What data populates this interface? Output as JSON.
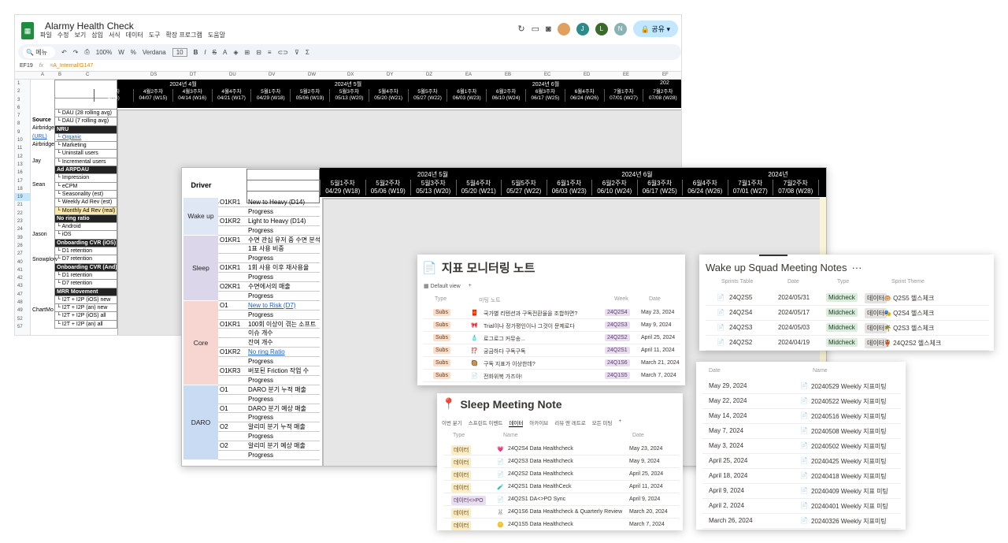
{
  "sheet1": {
    "title": "Alarmy Health Check",
    "menu": [
      "파일",
      "수정",
      "보기",
      "삽입",
      "서식",
      "데이터",
      "도구",
      "확장 프로그램",
      "도움말"
    ],
    "avatars": [
      "J",
      "L",
      "N"
    ],
    "share_label": "공유",
    "search_label": "메뉴",
    "zoom": "100%",
    "font": "Verdana",
    "font_size": "10",
    "cell_ref": "EF19",
    "formula": "=A_Internal!G147",
    "col_headers": [
      "A",
      "B",
      "C",
      "DS",
      "DT",
      "DU",
      "DV",
      "DW",
      "DX",
      "DY",
      "DZ",
      "EA",
      "EB",
      "EC",
      "ED",
      "EE",
      "EF"
    ],
    "row_numbers": [
      "1",
      "2",
      "3",
      "6",
      "7",
      "8",
      "9",
      "10",
      "11",
      "12",
      "13",
      "16",
      "17",
      "18",
      "19",
      "21",
      "22",
      "23",
      "24",
      "39",
      "26",
      "27",
      "40",
      "41",
      "42",
      "43",
      "47",
      "48",
      "49",
      "52",
      "57"
    ],
    "drivers": [
      "Source",
      "Airbridge",
      "(URL)",
      "Airbridge",
      "Jay",
      "Sean",
      "Jason",
      "Snowplow",
      "ChartMo"
    ],
    "labels": [
      {
        "text": "DAU (28 rolling avg)",
        "style": ""
      },
      {
        "text": "DAU (7 rolling avg)",
        "style": ""
      },
      {
        "text": "NRU",
        "style": "dark"
      },
      {
        "text": "Organic",
        "style": "link"
      },
      {
        "text": "Marketing",
        "style": ""
      },
      {
        "text": "Uninstall users",
        "style": ""
      },
      {
        "text": "Incremental users",
        "style": ""
      },
      {
        "text": "Ad ARPDAU",
        "style": "dark"
      },
      {
        "text": "Impression",
        "style": ""
      },
      {
        "text": "eCPM",
        "style": ""
      },
      {
        "text": "Seasonality (est)",
        "style": ""
      },
      {
        "text": "Weekly Ad Rev (est)",
        "style": ""
      },
      {
        "text": "Monthly Ad Rev (real)",
        "style": "hl"
      },
      {
        "text": "No ring ratio",
        "style": "dark"
      },
      {
        "text": "Android",
        "style": ""
      },
      {
        "text": "iOS",
        "style": ""
      },
      {
        "text": "Onboarding CVR (iOS)",
        "style": "dark"
      },
      {
        "text": "D1 retention",
        "style": ""
      },
      {
        "text": "D7 retention",
        "style": ""
      },
      {
        "text": "Onboarding CVR (And)",
        "style": "dark"
      },
      {
        "text": "D1 retention",
        "style": ""
      },
      {
        "text": "D7 retention",
        "style": ""
      },
      {
        "text": "MRR Movement",
        "style": "dark"
      },
      {
        "text": "I2T + I2P (iOS) new",
        "style": ""
      },
      {
        "text": "I2T + I2P (an) new",
        "style": ""
      },
      {
        "text": "I2T + I2P (iOS) all",
        "style": ""
      },
      {
        "text": "I2T + I2P (an) all",
        "style": ""
      }
    ],
    "month_groups": [
      "2024년 4월",
      "2024년 5월",
      "2024년 6월",
      "202"
    ],
    "weeks": [
      {
        "a": "3주차",
        "b": "4/14)"
      },
      {
        "a": "4월2주차",
        "b": "04/07 (W15)"
      },
      {
        "a": "4월3주차",
        "b": "04/14 (W16)"
      },
      {
        "a": "4월4주차",
        "b": "04/21 (W17)"
      },
      {
        "a": "5월1주차",
        "b": "04/29 (W18)"
      },
      {
        "a": "5월2주차",
        "b": "05/06 (W19)"
      },
      {
        "a": "5월3주차",
        "b": "05/13 (W20)"
      },
      {
        "a": "5월4주차",
        "b": "05/20 (W21)"
      },
      {
        "a": "5월5주차",
        "b": "05/27 (W22)"
      },
      {
        "a": "6월1주차",
        "b": "06/03 (W23)"
      },
      {
        "a": "6월2주차",
        "b": "06/10 (W24)"
      },
      {
        "a": "6월3주차",
        "b": "06/17 (W25)"
      },
      {
        "a": "6월4주차",
        "b": "06/24 (W26)"
      },
      {
        "a": "7월1주차",
        "b": "07/01 (W27)"
      },
      {
        "a": "7월2주차",
        "b": "07/08 (W28)"
      }
    ]
  },
  "sheet2": {
    "driver_label": "Driver",
    "month_groups": [
      "2024년 5월",
      "2024년 6월",
      "2024년"
    ],
    "weeks": [
      {
        "a": "5월1주차",
        "b": "04/29 (W18)"
      },
      {
        "a": "5월2주차",
        "b": "05/06 (W19)"
      },
      {
        "a": "5월3주차",
        "b": "05/13 (W20)"
      },
      {
        "a": "5월4주차",
        "b": "05/20 (W21)"
      },
      {
        "a": "5월5주차",
        "b": "05/27 (W22)"
      },
      {
        "a": "6월1주차",
        "b": "06/03 (W23)"
      },
      {
        "a": "6월2주차",
        "b": "06/10 (W24)"
      },
      {
        "a": "6월3주차",
        "b": "06/17 (W25)"
      },
      {
        "a": "6월4주차",
        "b": "06/24 (W26)"
      },
      {
        "a": "7월1주차",
        "b": "07/01 (W27)"
      },
      {
        "a": "7월2주차",
        "b": "07/08 (W28)"
      },
      {
        "a": "7",
        "b": "07/"
      }
    ],
    "groups": [
      {
        "name": "Wake up",
        "color": "#dfe7f5",
        "rows": 4
      },
      {
        "name": "Sleep",
        "color": "#dcd6ea",
        "rows": 7
      },
      {
        "name": "Core",
        "color": "#f7d6d2",
        "rows": 9
      },
      {
        "name": "DARO",
        "color": "#c9daf3",
        "rows": 8
      }
    ],
    "rows": [
      {
        "kr": "O1KR1",
        "label": "New to Heavy (D14)",
        "link": false
      },
      {
        "kr": "",
        "label": "Progress",
        "link": false
      },
      {
        "kr": "O1KR2",
        "label": "Light to Heavy (D14)",
        "link": false
      },
      {
        "kr": "",
        "label": "Progress",
        "link": false
      },
      {
        "kr": "O1KR1",
        "label": "수면 관심 유저 중 수면 분석",
        "link": false
      },
      {
        "kr": "",
        "label": "1표 사용 비중",
        "link": false
      },
      {
        "kr": "",
        "label": "Progress",
        "link": false
      },
      {
        "kr": "O1KR1",
        "label": "1회 사용 이후 재사용율",
        "link": false
      },
      {
        "kr": "",
        "label": "Progress",
        "link": false
      },
      {
        "kr": "O2KR1",
        "label": "수면에서의 매출",
        "link": false
      },
      {
        "kr": "",
        "label": "Progress",
        "link": false
      },
      {
        "kr": "O1",
        "label": "New to Risk (D7)",
        "link": true
      },
      {
        "kr": "",
        "label": "Progress",
        "link": false
      },
      {
        "kr": "O1KR1",
        "label": "100회 이상이 겪는 소프트",
        "link": false
      },
      {
        "kr": "",
        "label": "이슈 개수",
        "link": false
      },
      {
        "kr": "",
        "label": "잔여 개수",
        "link": false
      },
      {
        "kr": "O1KR2",
        "label": "No ring Ratio",
        "link": true
      },
      {
        "kr": "",
        "label": "Progress",
        "link": false
      },
      {
        "kr": "O1KR3",
        "label": "버포된 Friction 작업 수",
        "link": false
      },
      {
        "kr": "",
        "label": "Progress",
        "link": false
      },
      {
        "kr": "O1",
        "label": "DARO 분기 누적 매출",
        "link": false
      },
      {
        "kr": "",
        "label": "Progress",
        "link": false
      },
      {
        "kr": "O1",
        "label": "DARO 분기 예상 매출",
        "link": false
      },
      {
        "kr": "",
        "label": "Progress",
        "link": false
      },
      {
        "kr": "O2",
        "label": "알리미 분기 누적 매출",
        "link": false
      },
      {
        "kr": "",
        "label": "Progress",
        "link": false
      },
      {
        "kr": "O2",
        "label": "알리미 분기 예상 매출",
        "link": false
      },
      {
        "kr": "",
        "label": "Progress",
        "link": false
      }
    ]
  },
  "card1": {
    "title": "지표 모니터링 노트",
    "view": "Default view",
    "headers": [
      "Type",
      "미팅 노트",
      "Week",
      "Date"
    ],
    "rows": [
      {
        "type": "Subs",
        "emoji": "🧧",
        "name": "국가별 리텐션과 구독전환율을 조합하면?",
        "week": "24Q2S4",
        "date": "May 23, 2024"
      },
      {
        "type": "Subs",
        "emoji": "🎀",
        "name": "Trial이나 정가평인이나 그것이 문제로다",
        "week": "24Q2S3",
        "date": "May 9, 2024"
      },
      {
        "type": "Subs",
        "emoji": "🧴",
        "name": "로그로그 커뮤송...",
        "week": "24Q2S2",
        "date": "April 25, 2024"
      },
      {
        "type": "Subs",
        "emoji": "⁉️",
        "name": "궁금하다 구독구독",
        "week": "24Q2S1",
        "date": "April 11, 2024"
      },
      {
        "type": "Subs",
        "emoji": "🥘",
        "name": "구독 지표가 이상한데?",
        "week": "24Q1S6",
        "date": "March 21, 2024"
      },
      {
        "type": "Subs",
        "emoji": "📄",
        "name": "전화위복 가즈아!",
        "week": "24Q1S5",
        "date": "March 7, 2024"
      }
    ]
  },
  "card2": {
    "title": "Wake up Squad Meeting Notes",
    "headers": [
      "Sprints Table",
      "Date",
      "Type",
      "Sprint Theme"
    ],
    "rows": [
      {
        "sprint": "24Q2S5",
        "date": "2024/05/31",
        "type": "Midcheck",
        "type2": "데이터",
        "theme": "🐵 Q2S5 헬스체크"
      },
      {
        "sprint": "24Q2S4",
        "date": "2024/05/17",
        "type": "Midcheck",
        "type2": "데이터",
        "theme": "🎭 Q2S4 헬스체크"
      },
      {
        "sprint": "24Q2S3",
        "date": "2024/05/03",
        "type": "Midcheck",
        "type2": "데이터",
        "theme": "🌴 Q2S3 헬스체크"
      },
      {
        "sprint": "24Q2S2",
        "date": "2024/04/19",
        "type": "Midcheck",
        "type2": "데이터",
        "theme": "🏺 24Q2S2 헬스체크"
      }
    ]
  },
  "card3": {
    "title": "Sleep Meeting Note",
    "tabs": [
      "이번 분기",
      "스프린트 이벤트",
      "데이터",
      "아카이브",
      "리뷰 앤 레트로",
      "모든 미팅"
    ],
    "active_tab": "데이터",
    "headers": [
      "Type",
      "Name",
      "Date"
    ],
    "rows": [
      {
        "type": "데이터",
        "emoji": "💗",
        "name": "24Q2S4 Data Healthcheck",
        "date": "May 23, 2024"
      },
      {
        "type": "데이터",
        "emoji": "📄",
        "name": "24Q2S3 Data Healthcheck",
        "date": "May 9, 2024"
      },
      {
        "type": "데이터",
        "emoji": "📄",
        "name": "24Q2S2 Data Healthcheck",
        "date": "April 25, 2024"
      },
      {
        "type": "데이터",
        "emoji": "🧪",
        "name": "24Q2S1 Data HealthCeck",
        "date": "April 11, 2024"
      },
      {
        "type": "데이터<>PO",
        "emoji": "📄",
        "name": "24Q2S1 DA<>PO Sync",
        "date": "April 9, 2024"
      },
      {
        "type": "데이터",
        "emoji": "🐰",
        "name": "24Q1S6 Data Healthcheck & Quarterly Review",
        "date": "March 20, 2024"
      },
      {
        "type": "데이터",
        "emoji": "🪙",
        "name": "24Q1S5 Data Healthcheck",
        "date": "March 7, 2024"
      }
    ]
  },
  "card4": {
    "headers": [
      "Date",
      "Name"
    ],
    "rows": [
      {
        "date": "May 29, 2024",
        "name": "20240529 Weekly 지표미팅"
      },
      {
        "date": "May 22, 2024",
        "name": "20240522 Weekly 지표미팅"
      },
      {
        "date": "May 14, 2024",
        "name": "20240516 Weekly 지표미팅"
      },
      {
        "date": "May 7, 2024",
        "name": "20240508 Weekly 지표미팅"
      },
      {
        "date": "May 3, 2024",
        "name": "20240502 Weekly 지표미팅"
      },
      {
        "date": "April 25, 2024",
        "name": "20240425 Weekly 지표미팅"
      },
      {
        "date": "April 18, 2024",
        "name": "20240418 Weekly 지표미팅"
      },
      {
        "date": "April 9, 2024",
        "name": "20240409 Weekly 지표 미팅"
      },
      {
        "date": "April 2, 2024",
        "name": "20240401 Weekly 지표 미팅"
      },
      {
        "date": "March 26, 2024",
        "name": "20240326 Weekly 지표미팅"
      }
    ]
  }
}
